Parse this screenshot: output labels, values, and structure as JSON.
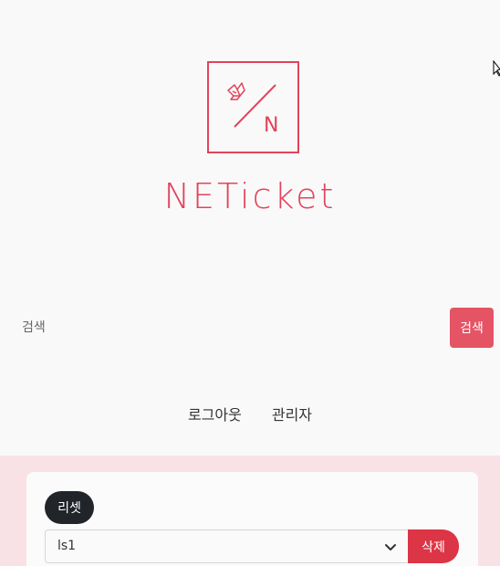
{
  "brand": {
    "logo_letter": "N",
    "name": "NETicket",
    "accent_color": "#e2435a"
  },
  "search": {
    "placeholder": "검색",
    "button_label": "검색"
  },
  "nav": {
    "items": [
      {
        "label": "로그아웃"
      },
      {
        "label": "관리자"
      }
    ]
  },
  "preset_panel": {
    "reset_label": "리셋",
    "selected_preset": "ls1",
    "delete_label": "삭제"
  }
}
